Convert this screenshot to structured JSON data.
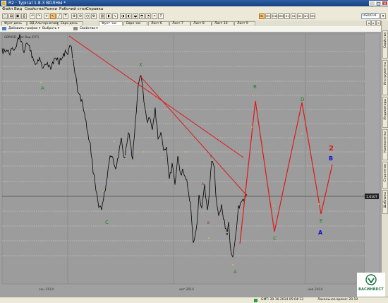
{
  "window": {
    "title": "R2 · Typical 1.8.3 ВОЛНЫ *",
    "minimize": "_",
    "maximize": "□",
    "close": "×"
  },
  "menu": [
    "Файл",
    "Вид",
    "Свойства",
    "Рынки",
    "Рабочий стол",
    "Справка"
  ],
  "toolbar": {
    "currency": "USD/CHF",
    "icons": [
      "new-icon",
      "open-icon",
      "save-icon",
      "print-icon",
      "undo-icon",
      "redo-icon",
      "crosshair-icon",
      "pointer-icon",
      "line-icon",
      "text-icon",
      "zoom-in-icon",
      "zoom-out-icon",
      "period-icon",
      "settings-icon",
      "bar-chart-icon",
      "candle-chart-icon",
      "line-chart-icon",
      "timeframe-icon",
      "timeframe-h4-icon",
      "timeframe-d1-icon",
      "timeframe-w1-icon",
      "timeframe-mn-icon",
      "cursor-icon",
      "help-icon"
    ],
    "buttons": [
      "M1",
      "M5",
      "M15",
      "M30",
      "H1",
      "H4",
      "D1",
      "W1",
      "MN"
    ]
  },
  "tabs": [
    "Фунт день",
    "ВД Альтернатива",
    "Евро день",
    "Фунт час",
    "Евро час",
    "Лист 6",
    "Лист 7",
    "Лист 8",
    "Лист 10",
    "Лист 9"
  ],
  "active_tab": 3,
  "chart_toolbar": {
    "add_chart": "Добавить график ▾",
    "select": "Выбрать ▾",
    "properties": "Свойства ▾"
  },
  "chart": {
    "header_label": "GBPUSD · Час Вид (FXT)",
    "price_label": "1.6107",
    "x_labels": [
      "сен 2014",
      "окт 2014",
      "ноя 2014"
    ],
    "wave_labels_green": [
      "A",
      "X",
      "C",
      "B",
      "D",
      "C",
      "E",
      "A"
    ],
    "wave_labels_small": [
      "A",
      "B",
      "C"
    ],
    "wave_labels_blue": [
      "B",
      "A"
    ],
    "count_label": "2",
    "colors": {
      "background": "#9d9d9d",
      "price": "#000000",
      "trend": "#e01818",
      "wave_green": "#1a8a1a",
      "wave_blue": "#1010d0",
      "small_labels": "#d8c04a",
      "grid": "#ffffff"
    }
  },
  "right_panel": [
    "Свойства",
    "Инструменты",
    "Индикаторы",
    "Компоненты",
    "Стратегии",
    "Шаблоны"
  ],
  "status": {
    "gmt": "GMT: 20.10.2014 05:04:13",
    "local": "Локальное время: 20.10"
  },
  "logo": {
    "text": "ВАСИНВЕСТ"
  }
}
